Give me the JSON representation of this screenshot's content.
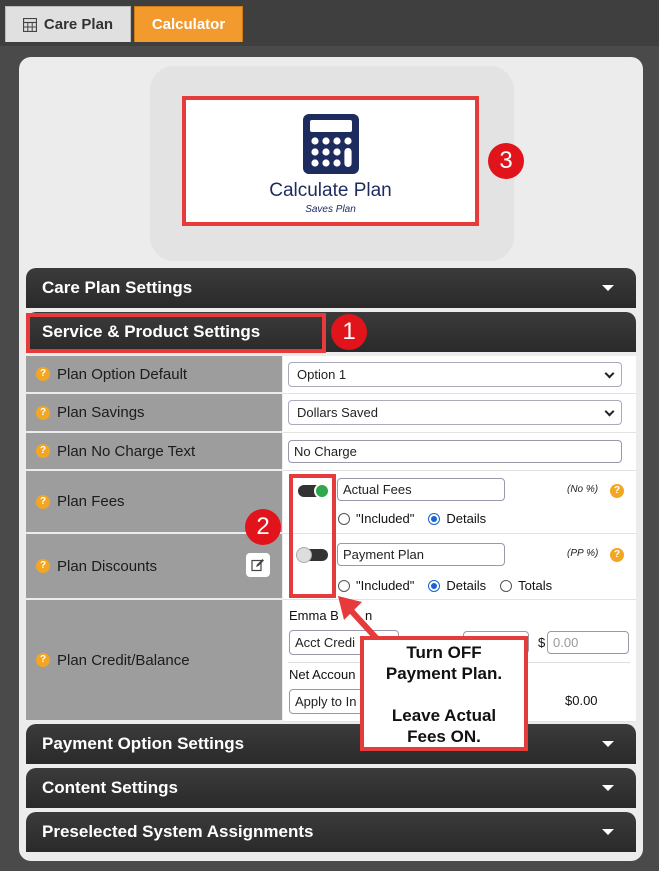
{
  "tabs": [
    {
      "label": "Care Plan",
      "icon": "calculator-grid-icon",
      "active": false
    },
    {
      "label": "Calculator",
      "active": true
    }
  ],
  "calculate": {
    "title": "Calculate Plan",
    "subtitle": "Saves Plan",
    "icon": "calculator-icon"
  },
  "badges": [
    "1",
    "2",
    "3"
  ],
  "sections": {
    "care_plan": "Care Plan Settings",
    "service_product": "Service & Product Settings",
    "payment_option": "Payment Option Settings",
    "content": "Content Settings",
    "preselected": "Preselected System Assignments"
  },
  "settings": {
    "plan_option_default": {
      "label": "Plan Option Default",
      "value": "Option 1"
    },
    "plan_savings": {
      "label": "Plan Savings",
      "value": "Dollars Saved"
    },
    "plan_no_charge_text": {
      "label": "Plan No Charge Text",
      "value": "No Charge"
    },
    "plan_fees": {
      "label": "Plan Fees",
      "toggle_on": true,
      "name_value": "Actual Fees",
      "note": "(No %)",
      "radios": [
        {
          "label": "\"Included\"",
          "checked": false
        },
        {
          "label": "Details",
          "checked": true
        }
      ]
    },
    "plan_discounts": {
      "label": "Plan Discounts",
      "toggle_on": false,
      "name_value": "Payment Plan",
      "note": "(PP %)",
      "radios": [
        {
          "label": "\"Included\"",
          "checked": false
        },
        {
          "label": "Details",
          "checked": true
        },
        {
          "label": "Totals",
          "checked": false
        }
      ]
    },
    "plan_credit_balance": {
      "label": "Plan Credit/Balance",
      "person_name": "Emma B",
      "person_name_tail": "n",
      "account_select": "Acct Credi",
      "currency_symbol": "$",
      "amount_placeholder": "0.00",
      "net_account_label": "Net Accoun",
      "apply_select": "Apply to In",
      "net_amount": "$0.00"
    }
  },
  "callout": {
    "line1": "Turn OFF",
    "line2": "Payment Plan.",
    "line3": "Leave Actual",
    "line4": "Fees ON."
  },
  "colors": {
    "accent_orange": "#f39a2e",
    "highlight_red": "#e53b3b",
    "toggle_on_green": "#2ea84a",
    "navy": "#1e2b5e"
  }
}
